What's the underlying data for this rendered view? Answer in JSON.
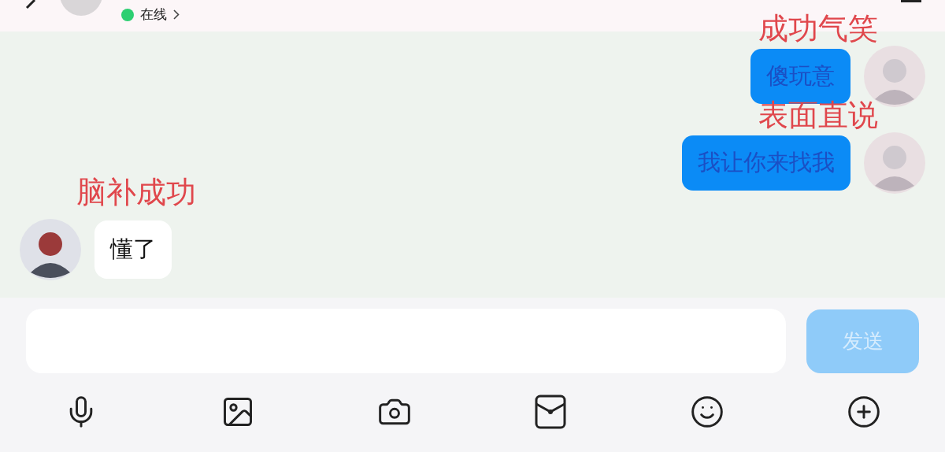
{
  "header": {
    "status": "在线",
    "online": true
  },
  "messages": [
    {
      "kind": "sent",
      "text": "傻玩意",
      "annotation": "成功气笑"
    },
    {
      "kind": "sent",
      "text": "我让你来找我",
      "annotation": "表面直说"
    },
    {
      "kind": "received",
      "text": "懂了",
      "annotation": "脑补成功"
    }
  ],
  "composer": {
    "send_label": "发送",
    "send_disabled": true
  }
}
